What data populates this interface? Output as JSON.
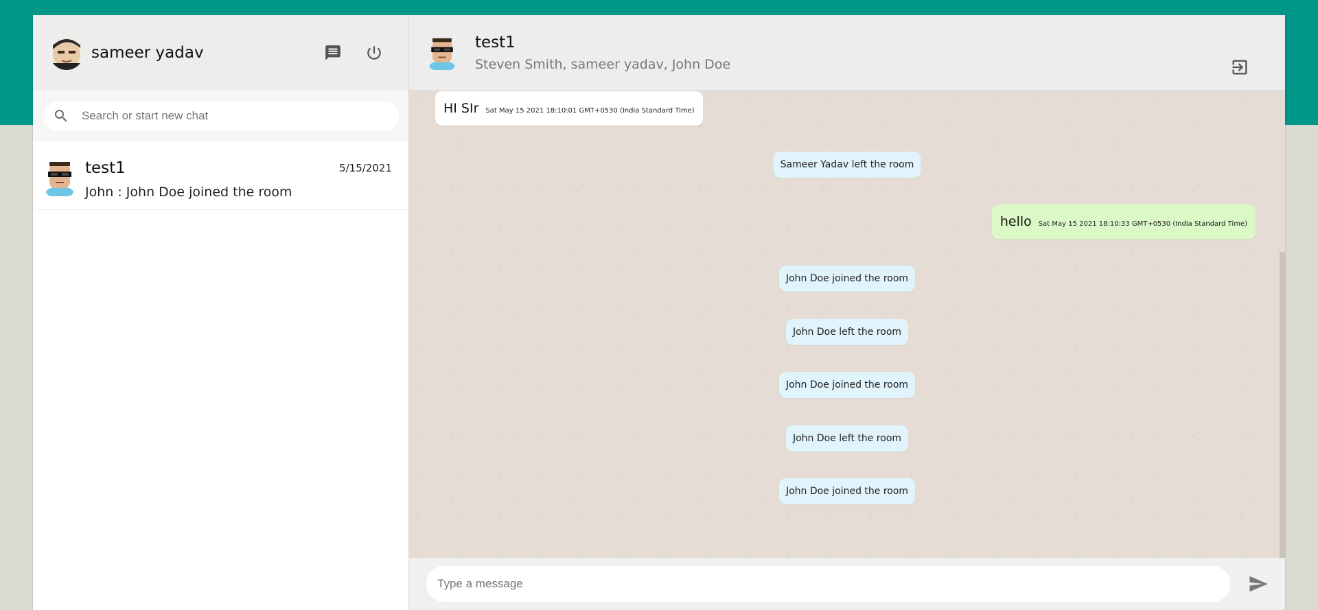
{
  "sidebar": {
    "username": "sameer yadav",
    "search": {
      "placeholder": "Search or start new chat"
    },
    "chats": [
      {
        "name": "test1",
        "date": "5/15/2021",
        "preview": "John : John Doe joined the room"
      }
    ]
  },
  "room": {
    "name": "test1",
    "members": "Steven Smith, sameer yadav, John Doe"
  },
  "messages": [
    {
      "type": "incoming",
      "text": "HI SIr",
      "time": "Sat May 15 2021 18:10:01 GMT+0530 (India Standard Time)"
    },
    {
      "type": "notice",
      "text": "Sameer Yadav left the room"
    },
    {
      "type": "outgoing",
      "text": "hello",
      "time": "Sat May 15 2021 18:10:33 GMT+0530 (India Standard Time)"
    },
    {
      "type": "notice",
      "text": "John Doe joined the room"
    },
    {
      "type": "notice",
      "text": "John Doe left the room"
    },
    {
      "type": "notice",
      "text": "John Doe joined the room"
    },
    {
      "type": "notice",
      "text": "John Doe left the room"
    },
    {
      "type": "notice",
      "text": "John Doe joined the room"
    }
  ],
  "composer": {
    "placeholder": "Type a message"
  },
  "icons": {
    "new_chat": "chat-icon",
    "logout": "power-icon",
    "search": "search-icon",
    "exit_room": "exit-icon",
    "send": "send-icon"
  },
  "colors": {
    "top_band": "#009688",
    "incoming_bubble": "#ffffff",
    "outgoing_bubble": "#dcf8c6",
    "notice_bubble": "#e1f3fb",
    "chat_background": "#e5ddd5"
  }
}
